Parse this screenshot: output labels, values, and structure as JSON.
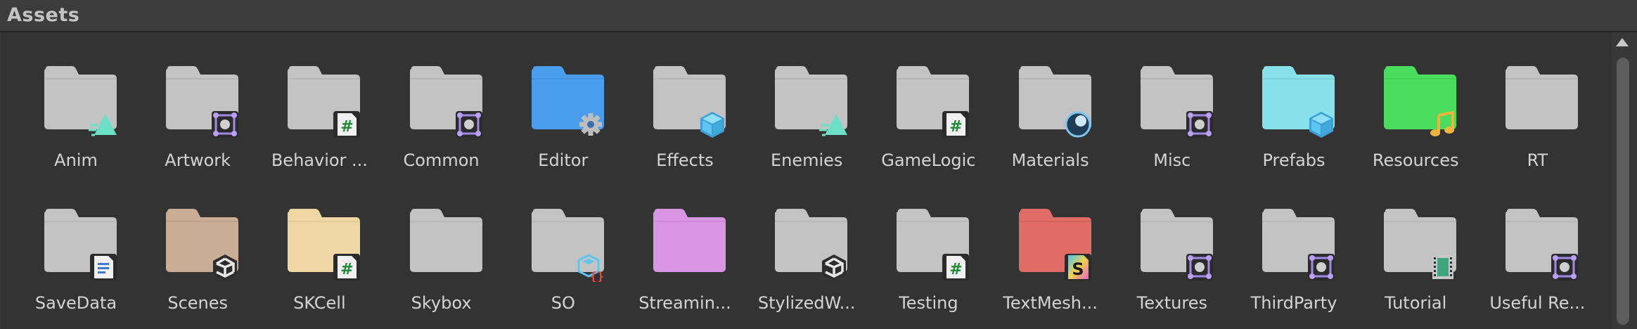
{
  "header": {
    "title": "Assets"
  },
  "colors": {
    "folder_default": "#c3c3c3",
    "folder_blue": "#4a9ced",
    "folder_cyan": "#87e1eb",
    "folder_green": "#49dc5d",
    "folder_tan": "#c9ad94",
    "folder_yellow": "#efd6a3",
    "folder_pink": "#d896e4",
    "folder_red": "#e06b67"
  },
  "items": [
    {
      "label": "Anim",
      "folder_color": "#c3c3c3",
      "badge": "animation-triangle-icon"
    },
    {
      "label": "Artwork",
      "folder_color": "#c3c3c3",
      "badge": "sprite-frame-icon"
    },
    {
      "label": "Behavior ...",
      "folder_color": "#c3c3c3",
      "badge": "csharp-script-icon"
    },
    {
      "label": "Common",
      "folder_color": "#c3c3c3",
      "badge": "sprite-frame-icon"
    },
    {
      "label": "Editor",
      "folder_color": "#4a9ced",
      "badge": "gear-icon"
    },
    {
      "label": "Effects",
      "folder_color": "#c3c3c3",
      "badge": "prefab-cube-icon"
    },
    {
      "label": "Enemies",
      "folder_color": "#c3c3c3",
      "badge": "animation-triangle-icon"
    },
    {
      "label": "GameLogic",
      "folder_color": "#c3c3c3",
      "badge": "csharp-script-icon"
    },
    {
      "label": "Materials",
      "folder_color": "#c3c3c3",
      "badge": "material-sphere-icon"
    },
    {
      "label": "Misc",
      "folder_color": "#c3c3c3",
      "badge": "sprite-frame-icon"
    },
    {
      "label": "Prefabs",
      "folder_color": "#87e1eb",
      "badge": "prefab-cube-icon"
    },
    {
      "label": "Resources",
      "folder_color": "#49dc5d",
      "badge": "music-note-icon"
    },
    {
      "label": "RT",
      "folder_color": "#c3c3c3",
      "badge": ""
    },
    {
      "label": "SaveData",
      "folder_color": "#c3c3c3",
      "badge": "text-document-icon"
    },
    {
      "label": "Scenes",
      "folder_color": "#c9ad94",
      "badge": "unity-logo-icon"
    },
    {
      "label": "SKCell",
      "folder_color": "#efd6a3",
      "badge": "csharp-script-icon"
    },
    {
      "label": "Skybox",
      "folder_color": "#c3c3c3",
      "badge": ""
    },
    {
      "label": "SO",
      "folder_color": "#c3c3c3",
      "badge": "scriptable-object-icon"
    },
    {
      "label": "Streamin...",
      "folder_color": "#d896e4",
      "badge": ""
    },
    {
      "label": "StylizedW...",
      "folder_color": "#c3c3c3",
      "badge": "unity-logo-icon"
    },
    {
      "label": "Testing",
      "folder_color": "#c3c3c3",
      "badge": "csharp-script-icon"
    },
    {
      "label": "TextMesh...",
      "folder_color": "#e06b67",
      "badge": "textmesh-font-icon"
    },
    {
      "label": "Textures",
      "folder_color": "#c3c3c3",
      "badge": "sprite-frame-icon"
    },
    {
      "label": "ThirdParty",
      "folder_color": "#c3c3c3",
      "badge": "sprite-frame-icon"
    },
    {
      "label": "Tutorial",
      "folder_color": "#c3c3c3",
      "badge": "film-strip-icon"
    },
    {
      "label": "Useful Re...",
      "folder_color": "#c3c3c3",
      "badge": "sprite-frame-icon"
    }
  ]
}
